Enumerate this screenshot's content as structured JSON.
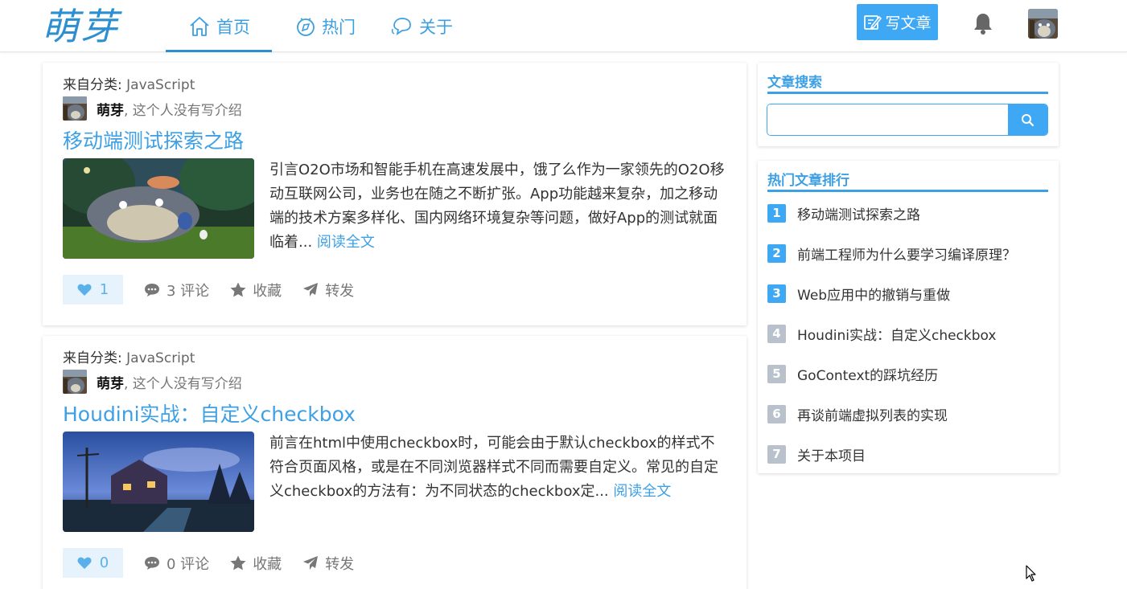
{
  "header": {
    "logo": "萌芽",
    "nav": [
      {
        "label": "首页",
        "icon": "home-icon"
      },
      {
        "label": "热门",
        "icon": "compass-icon"
      },
      {
        "label": "关于",
        "icon": "chat-bubbles-icon"
      }
    ],
    "write_label": "写文章"
  },
  "colors": {
    "accent": "#3ea8f5",
    "link": "#3ea0e4",
    "rank_top": "#3ea8f5",
    "rank_other": "#b9c2cc",
    "like_bg": "#e6f3fc"
  },
  "articles": [
    {
      "category_prefix": "来自分类:",
      "category": "JavaScript",
      "author_name": "萌芽",
      "author_intro": ", 这个人没有写介绍",
      "title": "移动端测试探索之路",
      "summary": "引言O2O市场和智能手机在高速发展中，饿了么作为一家领先的O2O移动互联网公司，业务也在随之不断扩张。App功能越来复杂，加之移动端的技术方案多样化、国内网络环境复杂等问题，做好App的测试就面临着...",
      "read_more": "阅读全文",
      "likes": "1",
      "comments": "3 评论",
      "collect": "收藏",
      "share": "转发"
    },
    {
      "category_prefix": "来自分类:",
      "category": "JavaScript",
      "author_name": "萌芽",
      "author_intro": ", 这个人没有写介绍",
      "title": "Houdini实战：自定义checkbox",
      "summary": "前言在html中使用checkbox时，可能会由于默认checkbox的样式不符合页面风格，或是在不同浏览器样式不同而需要自定义。常见的自定义checkbox的方法有：为不同状态的checkbox定...",
      "read_more": "阅读全文",
      "likes": "0",
      "comments": "0 评论",
      "collect": "收藏",
      "share": "转发"
    }
  ],
  "sidebar": {
    "search_title": "文章搜索",
    "search_placeholder": "",
    "rank_title": "热门文章排行",
    "rank": [
      {
        "num": "1",
        "title": "移动端测试探索之路"
      },
      {
        "num": "2",
        "title": "前端工程师为什么要学习编译原理？"
      },
      {
        "num": "3",
        "title": "Web应用中的撤销与重做"
      },
      {
        "num": "4",
        "title": "Houdini实战：自定义checkbox"
      },
      {
        "num": "5",
        "title": "GoContext的踩坑经历"
      },
      {
        "num": "6",
        "title": "再谈前端虚拟列表的实现"
      },
      {
        "num": "7",
        "title": "关于本项目"
      }
    ]
  }
}
